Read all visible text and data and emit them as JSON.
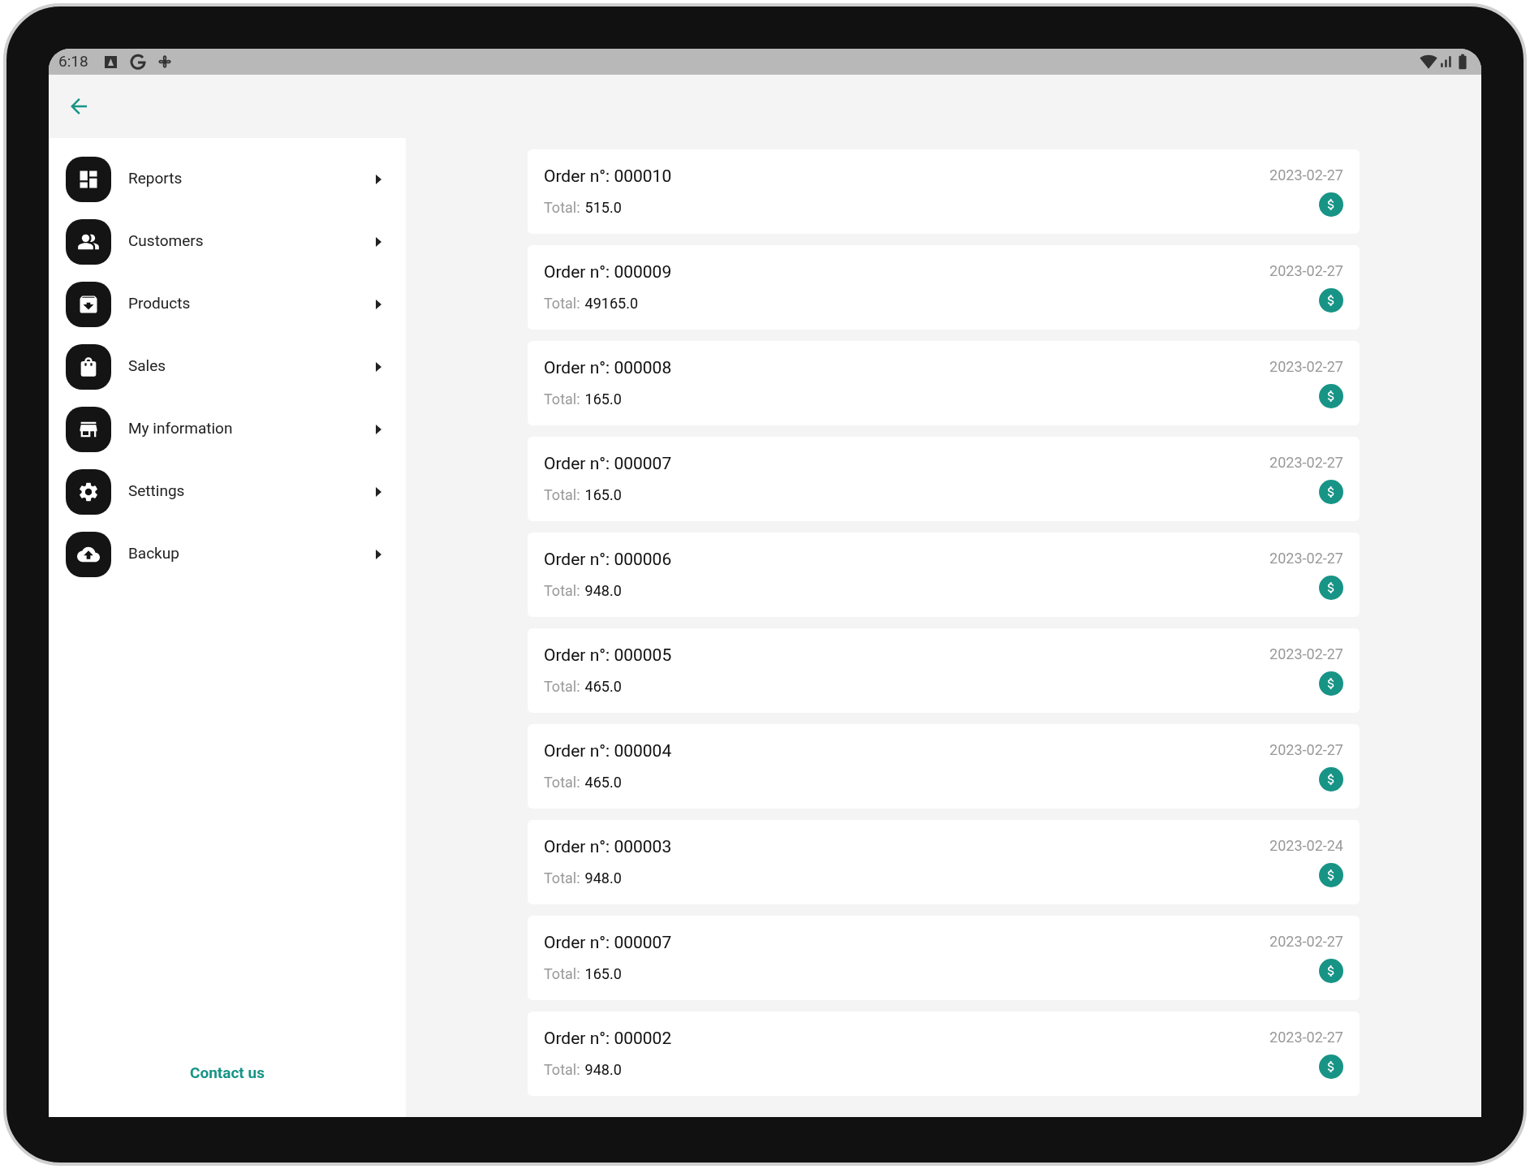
{
  "status_bar": {
    "time": "6:18"
  },
  "sidebar": {
    "items": [
      {
        "label": "Reports"
      },
      {
        "label": "Customers"
      },
      {
        "label": "Products"
      },
      {
        "label": "Sales"
      },
      {
        "label": "My information"
      },
      {
        "label": "Settings"
      },
      {
        "label": "Backup"
      }
    ],
    "footer_link": "Contact us"
  },
  "orders": [
    {
      "title": "Order n°: 000010",
      "total_label": "Total:",
      "total": "515.0",
      "date": "2023-02-27"
    },
    {
      "title": "Order n°: 000009",
      "total_label": "Total:",
      "total": "49165.0",
      "date": "2023-02-27"
    },
    {
      "title": "Order n°: 000008",
      "total_label": "Total:",
      "total": "165.0",
      "date": "2023-02-27"
    },
    {
      "title": "Order n°: 000007",
      "total_label": "Total:",
      "total": "165.0",
      "date": "2023-02-27"
    },
    {
      "title": "Order n°: 000006",
      "total_label": "Total:",
      "total": "948.0",
      "date": "2023-02-27"
    },
    {
      "title": "Order n°: 000005",
      "total_label": "Total:",
      "total": "465.0",
      "date": "2023-02-27"
    },
    {
      "title": "Order n°: 000004",
      "total_label": "Total:",
      "total": "465.0",
      "date": "2023-02-27"
    },
    {
      "title": "Order n°: 000003",
      "total_label": "Total:",
      "total": "948.0",
      "date": "2023-02-24"
    },
    {
      "title": "Order n°: 000007",
      "total_label": "Total:",
      "total": "165.0",
      "date": "2023-02-27"
    },
    {
      "title": "Order n°: 000002",
      "total_label": "Total:",
      "total": "948.0",
      "date": "2023-02-27"
    }
  ]
}
